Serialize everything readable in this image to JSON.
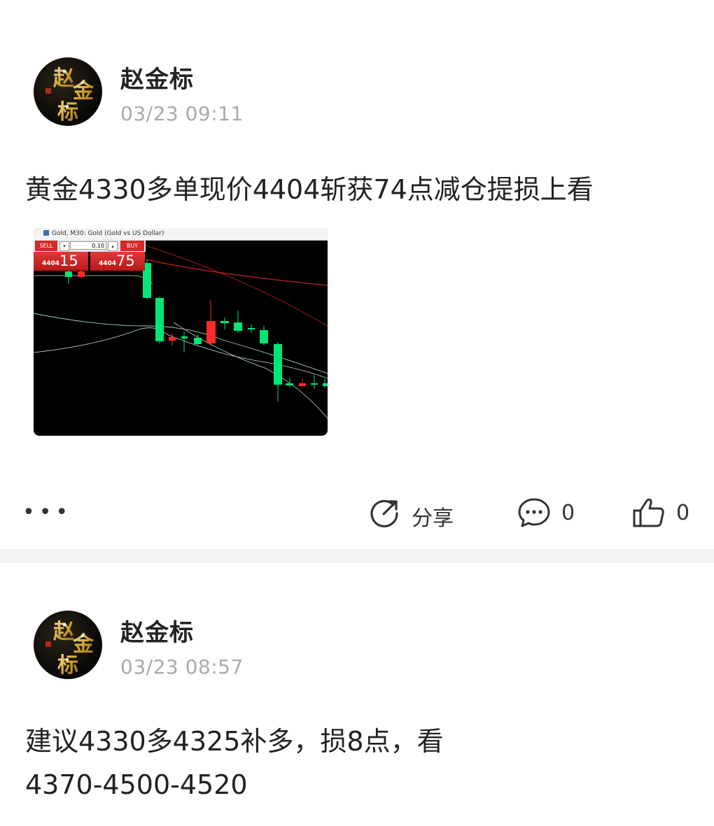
{
  "posts": [
    {
      "author": "赵金标",
      "time": "03/23 09:11",
      "content": "黄金4330多单现价4404斩获74点减仓提损上看",
      "chart_screenshot": {
        "window_title": "Gold, M30:  Gold (Gold vs US Dollar)",
        "sell_label": "SELL",
        "buy_label": "BUY",
        "lot_size": "0.10",
        "sell_price_prefix": "4404",
        "sell_price_big": "15",
        "buy_price_prefix": "4404",
        "buy_price_big": "75",
        "up_color": "#00e676",
        "down_color": "#ff2a2a"
      },
      "actions": {
        "share_label": "分享",
        "comment_count": "0",
        "like_count": "0"
      }
    },
    {
      "author": "赵金标",
      "time": "03/23 08:57",
      "content_line1": "建议4330多4325补多，损8点，看",
      "content_line2": "4370-4500-4520"
    }
  ],
  "colors": {
    "text": "#222222",
    "muted": "#aaaaaa",
    "divider": "#f2f4f6"
  }
}
